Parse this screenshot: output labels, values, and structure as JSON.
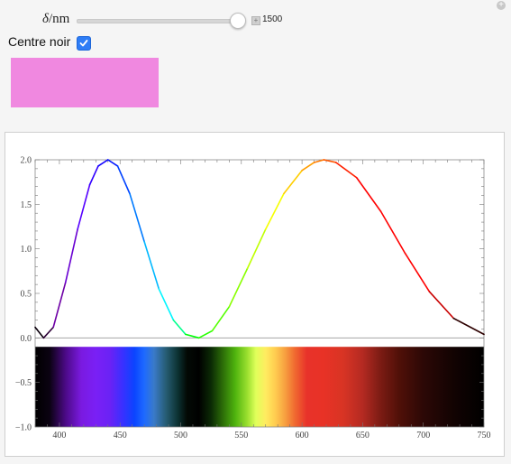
{
  "controls": {
    "slider": {
      "symbol": "δ",
      "unit_text": "/nm",
      "value": "1500",
      "plus_label": "+"
    },
    "checkbox": {
      "label": "Centre noir",
      "checked": true
    },
    "color_swatch": "#f088e0",
    "corner_button": "+"
  },
  "chart_data": {
    "type": "line",
    "x_range": [
      380,
      750
    ],
    "y_range": [
      -1.0,
      2.0
    ],
    "x_ticks": [
      "400",
      "450",
      "500",
      "550",
      "600",
      "650",
      "700",
      "750"
    ],
    "y_ticks": [
      "2.0",
      "1.5",
      "1.0",
      "0.5",
      "0.0",
      "−0.5",
      "−1.0"
    ],
    "curve_points": [
      [
        380,
        0.12
      ],
      [
        387,
        0.0
      ],
      [
        395,
        0.12
      ],
      [
        405,
        0.62
      ],
      [
        415,
        1.22
      ],
      [
        425,
        1.72
      ],
      [
        432,
        1.93
      ],
      [
        440,
        2.0
      ],
      [
        448,
        1.93
      ],
      [
        458,
        1.62
      ],
      [
        470,
        1.08
      ],
      [
        482,
        0.55
      ],
      [
        494,
        0.2
      ],
      [
        504,
        0.04
      ],
      [
        515,
        0.0
      ],
      [
        526,
        0.08
      ],
      [
        540,
        0.35
      ],
      [
        555,
        0.78
      ],
      [
        570,
        1.22
      ],
      [
        585,
        1.62
      ],
      [
        600,
        1.88
      ],
      [
        610,
        1.97
      ],
      [
        618,
        2.0
      ],
      [
        628,
        1.97
      ],
      [
        645,
        1.8
      ],
      [
        665,
        1.42
      ],
      [
        685,
        0.95
      ],
      [
        705,
        0.52
      ],
      [
        725,
        0.22
      ],
      [
        750,
        0.04
      ]
    ],
    "spectrum_band_y": [
      -1.0,
      -0.1
    ],
    "spectrum_stops": [
      {
        "x": 380,
        "c": "#000000"
      },
      {
        "x": 392,
        "c": "#0b0212"
      },
      {
        "x": 405,
        "c": "#4b0a86"
      },
      {
        "x": 418,
        "c": "#7a1ae0"
      },
      {
        "x": 430,
        "c": "#7a20f5"
      },
      {
        "x": 442,
        "c": "#6a22f5"
      },
      {
        "x": 452,
        "c": "#3a30ff"
      },
      {
        "x": 462,
        "c": "#0b45ff"
      },
      {
        "x": 470,
        "c": "#1e6aff"
      },
      {
        "x": 478,
        "c": "#3a7ac8"
      },
      {
        "x": 488,
        "c": "#265c72"
      },
      {
        "x": 498,
        "c": "#0b3030"
      },
      {
        "x": 505,
        "c": "#030a05"
      },
      {
        "x": 515,
        "c": "#000000"
      },
      {
        "x": 525,
        "c": "#0b2a05"
      },
      {
        "x": 535,
        "c": "#2d6f08"
      },
      {
        "x": 545,
        "c": "#4fb40e"
      },
      {
        "x": 555,
        "c": "#9ce030"
      },
      {
        "x": 562,
        "c": "#e0ff5a"
      },
      {
        "x": 570,
        "c": "#ffec60"
      },
      {
        "x": 578,
        "c": "#ffcc50"
      },
      {
        "x": 586,
        "c": "#f7a040"
      },
      {
        "x": 594,
        "c": "#f06a30"
      },
      {
        "x": 604,
        "c": "#e8322a"
      },
      {
        "x": 618,
        "c": "#e83226"
      },
      {
        "x": 634,
        "c": "#d83424"
      },
      {
        "x": 650,
        "c": "#b42a22"
      },
      {
        "x": 664,
        "c": "#7e1c14"
      },
      {
        "x": 680,
        "c": "#501008"
      },
      {
        "x": 700,
        "c": "#2c0806"
      },
      {
        "x": 725,
        "c": "#120302"
      },
      {
        "x": 750,
        "c": "#000000"
      }
    ]
  }
}
